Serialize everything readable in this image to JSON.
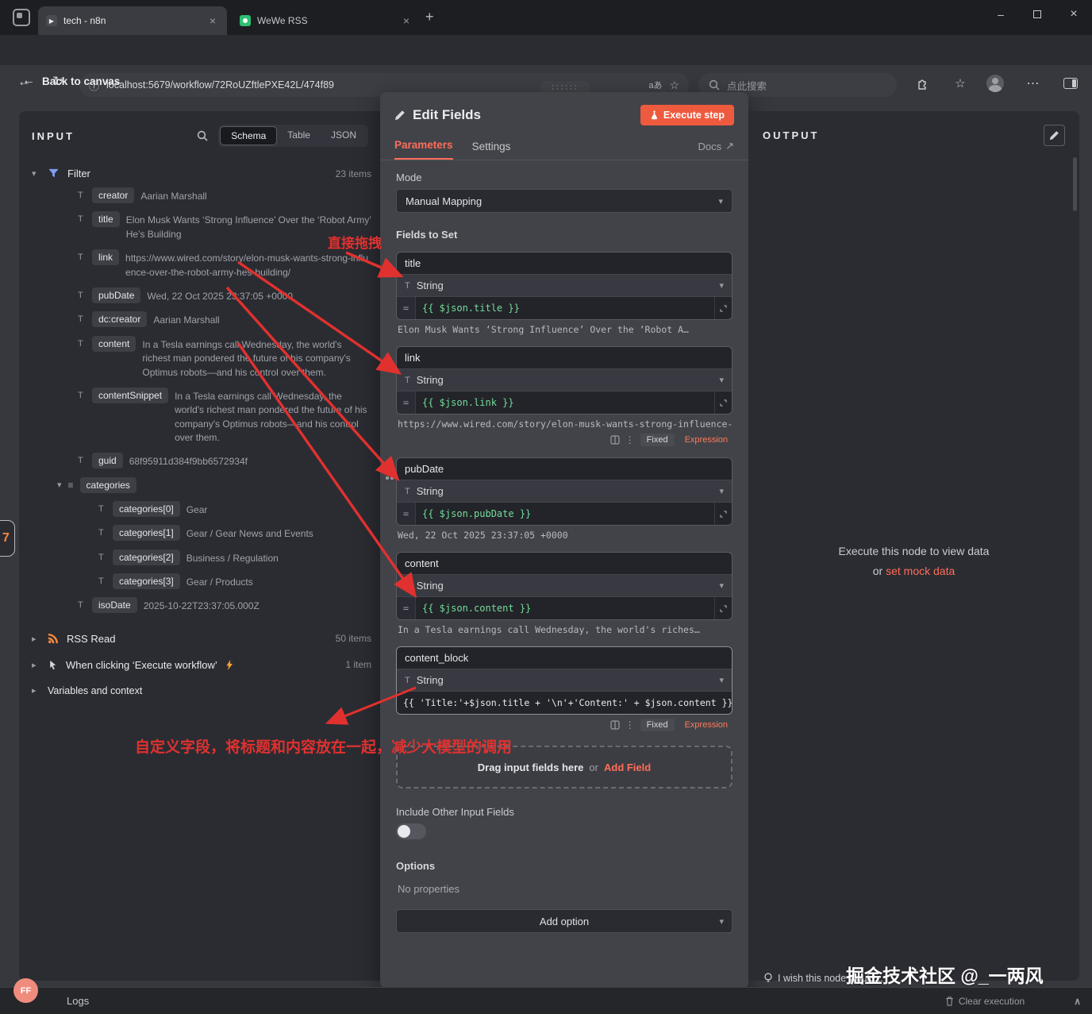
{
  "icons": {
    "string_type": "T",
    "equals": "="
  },
  "browser": {
    "tab1": "tech - n8n",
    "tab2": "WeWe RSS",
    "url": "localhost:5679/workflow/72RoUZftlePXE42L/474f89",
    "translate": "aあ",
    "search_placeholder": "点此搜索"
  },
  "canvas": {
    "back": "Back to canvas",
    "side_badge": "7",
    "watermark": "掘金技术社区 @_一两风",
    "feedback": "I wish this node would...",
    "logs": "Logs",
    "clear_execution": "Clear execution",
    "avatar": "FF"
  },
  "annotations": {
    "drag": "直接拖拽",
    "custom": "自定义字段，将标题和内容放在一起，减少大模型的调用"
  },
  "input": {
    "title": "INPUT",
    "tabs": {
      "schema": "Schema",
      "table": "Table",
      "json": "JSON"
    },
    "filter": {
      "name": "Filter",
      "count": "23 items"
    },
    "rows": [
      {
        "key": "creator",
        "value": "Aarian Marshall"
      },
      {
        "key": "title",
        "value": "Elon Musk Wants ‘Strong Influence’ Over the ‘Robot Army’ He’s Building"
      },
      {
        "key": "link",
        "value": "https://www.wired.com/story/elon-musk-wants-strong-influence-over-the-robot-army-hes-building/"
      },
      {
        "key": "pubDate",
        "value": "Wed, 22 Oct 2025 23:37:05 +0000"
      },
      {
        "key": "dc:creator",
        "value": "Aarian Marshall"
      },
      {
        "key": "content",
        "value": "In a Tesla earnings call Wednesday, the world's richest man pondered the future of his company's Optimus robots—and his control over them."
      },
      {
        "key": "contentSnippet",
        "value": "In a Tesla earnings call Wednesday, the world's richest man pondered the future of his company's Optimus robots—and his control over them."
      },
      {
        "key": "guid",
        "value": "68f95911d384f9bb6572934f"
      }
    ],
    "categories_key": "categories",
    "category_rows": [
      {
        "key": "categories[0]",
        "value": "Gear"
      },
      {
        "key": "categories[1]",
        "value": "Gear / Gear News and Events"
      },
      {
        "key": "categories[2]",
        "value": "Business / Regulation"
      },
      {
        "key": "categories[3]",
        "value": "Gear / Products"
      }
    ],
    "isoDate": {
      "key": "isoDate",
      "value": "2025-10-22T23:37:05.000Z"
    },
    "rss": {
      "name": "RSS Read",
      "count": "50 items"
    },
    "manual": {
      "name": "When clicking ‘Execute workflow’",
      "count": "1 item"
    },
    "variables": {
      "name": "Variables and context"
    }
  },
  "dialog": {
    "title": "Edit Fields",
    "execute": "Execute step",
    "tab_parameters": "Parameters",
    "tab_settings": "Settings",
    "docs": "Docs",
    "mode_label": "Mode",
    "mode_value": "Manual Mapping",
    "fields_label": "Fields to Set",
    "type_string": "String",
    "fixed": "Fixed",
    "expression": "Expression",
    "fields": [
      {
        "name": "title",
        "expr": "{{ $json.title }}",
        "preview": "Elon Musk Wants ‘Strong Influence’ Over the ‘Robot A…"
      },
      {
        "name": "link",
        "expr": "{{ $json.link }}",
        "preview": "https://www.wired.com/story/elon-musk-wants-strong-influence-ov…"
      },
      {
        "name": "pubDate",
        "expr": "{{ $json.pubDate }}",
        "preview": "Wed, 22 Oct 2025 23:37:05 +0000"
      },
      {
        "name": "content",
        "expr": "{{ $json.content }}",
        "preview": "In a Tesla earnings call Wednesday, the world's riches…"
      },
      {
        "name": "content_block",
        "expr": "{{ 'Title:'+$json.title + '\\n'+'Content:' + $json.content }}"
      }
    ],
    "drag_here": "Drag input fields here",
    "or": "or",
    "add_field": "Add Field",
    "include_label": "Include Other Input Fields",
    "options_label": "Options",
    "no_properties": "No properties",
    "add_option": "Add option"
  },
  "output": {
    "title": "OUTPUT",
    "message": "Execute this node to view data",
    "or": "or",
    "mock_link": "set mock data"
  }
}
